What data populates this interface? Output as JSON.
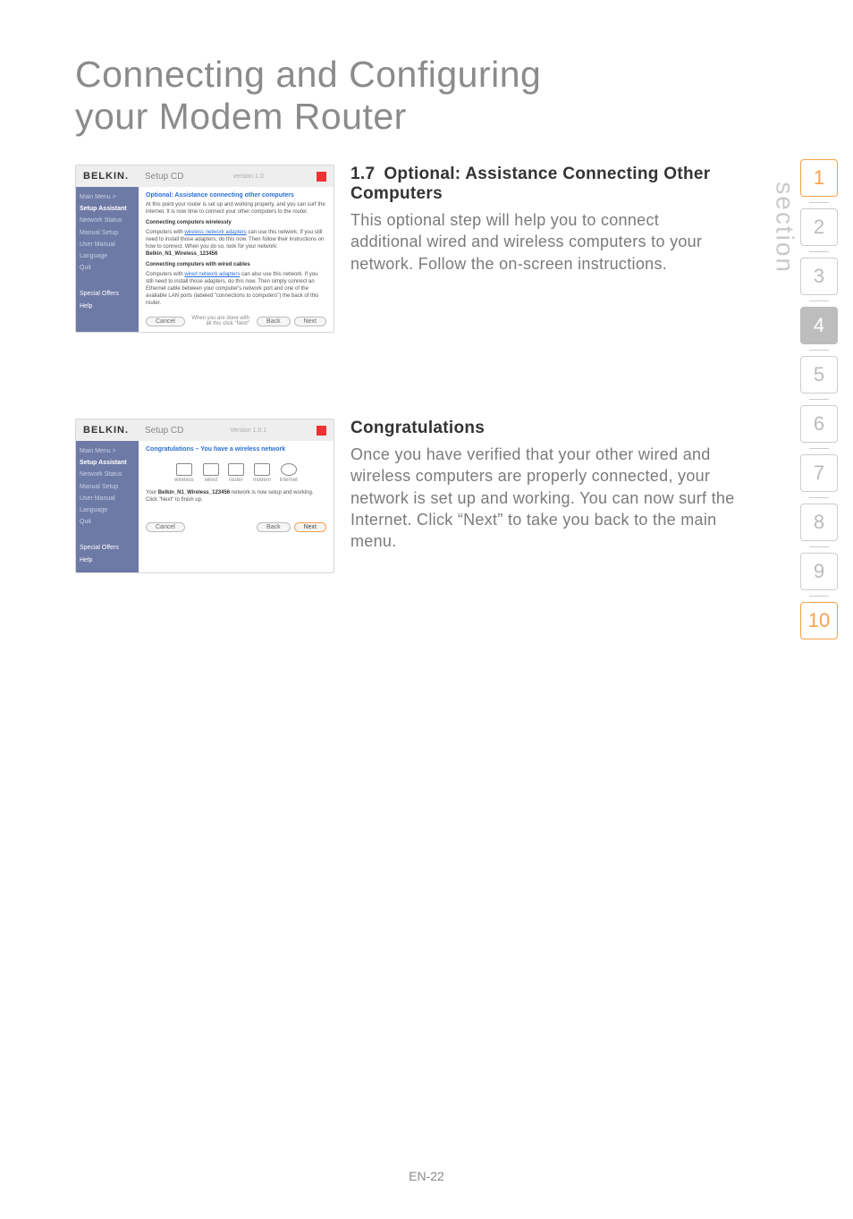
{
  "page_title_l1": "Connecting and Configuring",
  "page_title_l2": "your Modem Router",
  "section_label": "section",
  "section_numbers": [
    "1",
    "2",
    "3",
    "4",
    "5",
    "6",
    "7",
    "8",
    "9",
    "10"
  ],
  "active_section_index": 3,
  "page_number": "EN-22",
  "shot1": {
    "logo": "BELKIN.",
    "subtitle": "Setup CD",
    "version": "version 1.0",
    "sidebar": {
      "items": [
        "Main Menu  >",
        "Setup Assistant",
        "Network Status",
        "Manual Setup",
        "User Manual",
        "Language",
        "Quit"
      ],
      "bottom": [
        "Special Offers",
        "Help"
      ],
      "selected_index": 1
    },
    "heading": "Optional: Assistance connecting other computers",
    "intro": "At this point your router is set up and working properly, and you can surf the internet. It is now time to connect your other computers to the router.",
    "wireless_title": "Connecting computers wirelessly",
    "wireless_body_pre": "Computers with ",
    "wireless_link": "wireless network adapters",
    "wireless_body_post": " can use this network. If you still need to install those adapters, do this now. Then follow their instructions on how to connect. When you do so, look for your network: ",
    "network_name": "Belkin_N1_Wireless_123456",
    "wired_title": "Connecting computers with wired cables",
    "wired_body_pre": "Computers with ",
    "wired_link": "wired network adapters",
    "wired_body_post": " can also use this network. If you still need to install those adapters, do this now. Then simply connect an Ethernet cable between your computer's network port and one of the available LAN ports (labeled \"connections to computers\") the back of this router.",
    "footer_note": "When you are done with all this click \"Next\"",
    "btn_cancel": "Cancel",
    "btn_back": "Back",
    "btn_next": "Next"
  },
  "section1": {
    "heading_num": "1.7",
    "heading_txt": "Optional: Assistance Connecting Other Computers",
    "body": "This optional step will help you to connect additional wired and wireless computers to your network. Follow the on-screen instructions."
  },
  "shot2": {
    "logo": "BELKIN.",
    "subtitle": "Setup CD",
    "version": "Version 1.0.1",
    "sidebar": {
      "items": [
        "Main Menu  >",
        "Setup Assistant",
        "Network Status",
        "Manual Setup",
        "User Manual",
        "Language",
        "Quit"
      ],
      "bottom": [
        "Special Offers",
        "Help"
      ],
      "selected_index": 1
    },
    "heading": "Congratulations – You have a wireless network",
    "icons": [
      "wireless",
      "wired",
      "router",
      "modem",
      "internet"
    ],
    "status_pre": "Your ",
    "status_bold": "Belkin_N1_Wireless_123456",
    "status_post": " network is now setup and working. Click \"Next\" to finish up.",
    "btn_cancel": "Cancel",
    "btn_back": "Back",
    "btn_next": "Next"
  },
  "section2": {
    "heading": "Congratulations",
    "body": "Once you have verified that your other wired and wireless computers are properly connected, your network is set up and working. You can now surf the Internet. Click “Next” to take you back to the main menu."
  }
}
